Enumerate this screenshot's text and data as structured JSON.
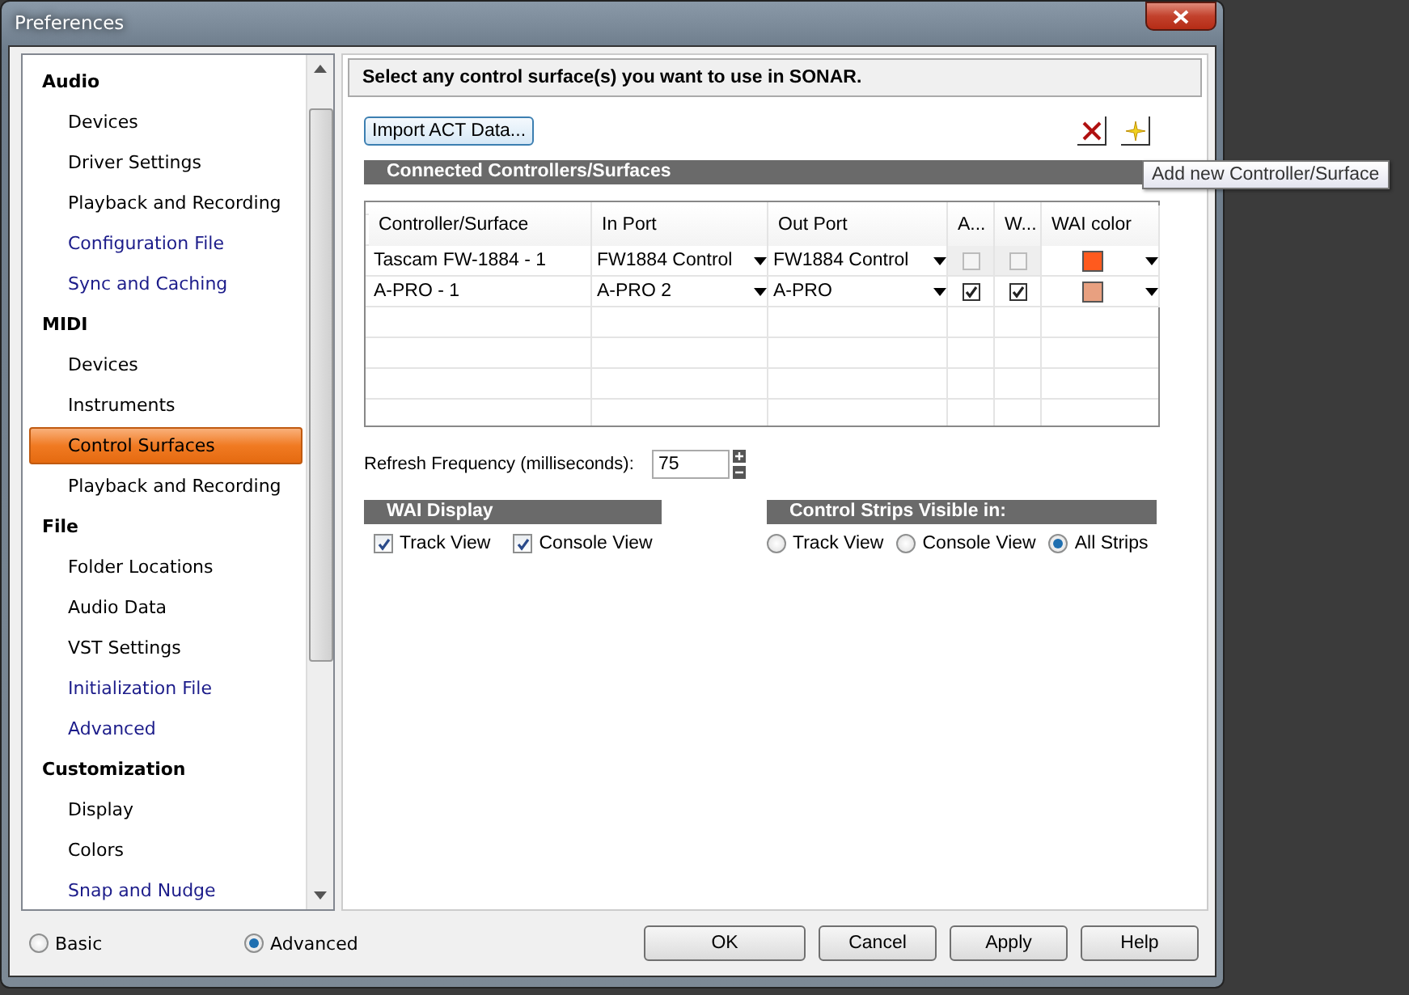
{
  "window": {
    "title": "Preferences"
  },
  "sidebar": {
    "items": [
      {
        "kind": "header",
        "label": "Audio"
      },
      {
        "kind": "item",
        "label": "Devices",
        "color": "#000000",
        "selected": false
      },
      {
        "kind": "item",
        "label": "Driver Settings",
        "color": "#000000",
        "selected": false
      },
      {
        "kind": "item",
        "label": "Playback and Recording",
        "color": "#000000",
        "selected": false
      },
      {
        "kind": "item",
        "label": "Configuration File",
        "color": "#1c1c8a",
        "selected": false
      },
      {
        "kind": "item",
        "label": "Sync and Caching",
        "color": "#1c1c8a",
        "selected": false
      },
      {
        "kind": "header",
        "label": "MIDI"
      },
      {
        "kind": "item",
        "label": "Devices",
        "color": "#000000",
        "selected": false
      },
      {
        "kind": "item",
        "label": "Instruments",
        "color": "#000000",
        "selected": false
      },
      {
        "kind": "item",
        "label": "Control Surfaces",
        "color": "#000000",
        "selected": true
      },
      {
        "kind": "item",
        "label": "Playback and Recording",
        "color": "#000000",
        "selected": false
      },
      {
        "kind": "header",
        "label": "File"
      },
      {
        "kind": "item",
        "label": "Folder Locations",
        "color": "#000000",
        "selected": false
      },
      {
        "kind": "item",
        "label": "Audio Data",
        "color": "#000000",
        "selected": false
      },
      {
        "kind": "item",
        "label": "VST Settings",
        "color": "#000000",
        "selected": false
      },
      {
        "kind": "item",
        "label": "Initialization File",
        "color": "#1c1c8a",
        "selected": false
      },
      {
        "kind": "item",
        "label": "Advanced",
        "color": "#1c1c8a",
        "selected": false
      },
      {
        "kind": "header",
        "label": "Customization"
      },
      {
        "kind": "item",
        "label": "Display",
        "color": "#000000",
        "selected": false
      },
      {
        "kind": "item",
        "label": "Colors",
        "color": "#000000",
        "selected": false
      },
      {
        "kind": "item",
        "label": "Snap and Nudge",
        "color": "#1c1c8a",
        "selected": false
      }
    ]
  },
  "mode": [
    {
      "label": "Basic",
      "selected": false
    },
    {
      "label": "Advanced",
      "selected": true
    }
  ],
  "header": "Select any control surface(s) you want to use in SONAR.",
  "import_button": "Import ACT Data...",
  "tooltip": "Add new Controller/Surface",
  "section_title": "Connected Controllers/Surfaces",
  "table": {
    "columns": [
      "Controller/Surface",
      "In Port",
      "Out Port",
      "A...",
      "W...",
      "WAI color"
    ],
    "rows": [
      {
        "controller": "Tascam FW-1884 - 1",
        "in_port": "FW1884 Control",
        "out_port": "FW1884 Control",
        "a": {
          "checked": false,
          "disabled": true
        },
        "w": {
          "checked": false,
          "disabled": true
        },
        "color": "#ff5a1e"
      },
      {
        "controller": "A-PRO - 1",
        "in_port": "A-PRO 2",
        "out_port": "A-PRO",
        "a": {
          "checked": true,
          "disabled": false
        },
        "w": {
          "checked": true,
          "disabled": false
        },
        "color": "#e8a080"
      }
    ]
  },
  "refresh": {
    "label": "Refresh Frequency (milliseconds):",
    "value": "75"
  },
  "wai_display": {
    "title": "WAI Display",
    "options": [
      {
        "label": "Track View",
        "checked": true
      },
      {
        "label": "Console View",
        "checked": true
      }
    ]
  },
  "control_strips": {
    "title": "Control Strips Visible in:",
    "options": [
      {
        "label": "Track View",
        "selected": false
      },
      {
        "label": "Console View",
        "selected": false
      },
      {
        "label": "All Strips",
        "selected": true
      }
    ]
  },
  "buttons": [
    "OK",
    "Cancel",
    "Apply",
    "Help"
  ]
}
